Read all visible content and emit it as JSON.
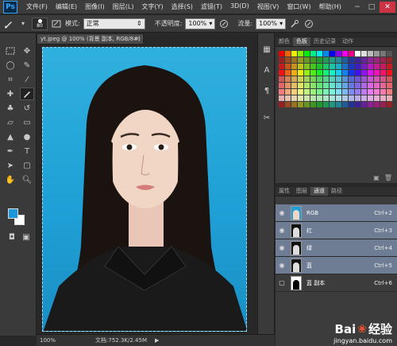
{
  "app": {
    "logo": "Ps"
  },
  "menu": [
    "文件(F)",
    "编辑(E)",
    "图像(I)",
    "图层(L)",
    "文字(Y)",
    "选择(S)",
    "滤镜(T)",
    "3D(D)",
    "视图(V)",
    "窗口(W)",
    "帮助(H)"
  ],
  "window_controls": {
    "minimize": "−",
    "maximize": "□",
    "close": "✕"
  },
  "options": {
    "brush_size": "80",
    "mode_label": "模式:",
    "mode_value": "正常",
    "opacity_label": "不透明度:",
    "opacity_value": "100%",
    "flow_label": "流量:",
    "flow_value": "100%"
  },
  "document": {
    "tab_title": "yt.jpeg @ 100% (背景 副本, RGB/8#) *",
    "tab_close": "×",
    "zoom": "100%",
    "doc_info": "文档:752.3K/2.45M"
  },
  "swatch_panel": {
    "tabs": [
      "颜色",
      "色板",
      "历史记录",
      "动作"
    ],
    "active_tab": 1
  },
  "channels_panel": {
    "tabs": [
      "属性",
      "图层",
      "通道",
      "路径"
    ],
    "active_tab": 2,
    "rows": [
      {
        "name": "RGB",
        "shortcut": "Ctrl+2",
        "thumb": "rgb",
        "selected": true,
        "visible": true
      },
      {
        "name": "红",
        "shortcut": "Ctrl+3",
        "thumb": "gray",
        "selected": true,
        "visible": true
      },
      {
        "name": "绿",
        "shortcut": "Ctrl+4",
        "thumb": "gray",
        "selected": true,
        "visible": true
      },
      {
        "name": "蓝",
        "shortcut": "Ctrl+5",
        "thumb": "gray",
        "selected": true,
        "visible": true
      },
      {
        "name": "蓝 副本",
        "shortcut": "Ctrl+6",
        "thumb": "alpha",
        "selected": false,
        "visible": false
      }
    ]
  },
  "watermark": {
    "brand": "Bai",
    "text": "经验",
    "url": "jingyan.baidu.com"
  },
  "colors": {
    "foreground": "#1e97d8",
    "background": "#ffffff",
    "selected_row": "#6f7d94"
  }
}
